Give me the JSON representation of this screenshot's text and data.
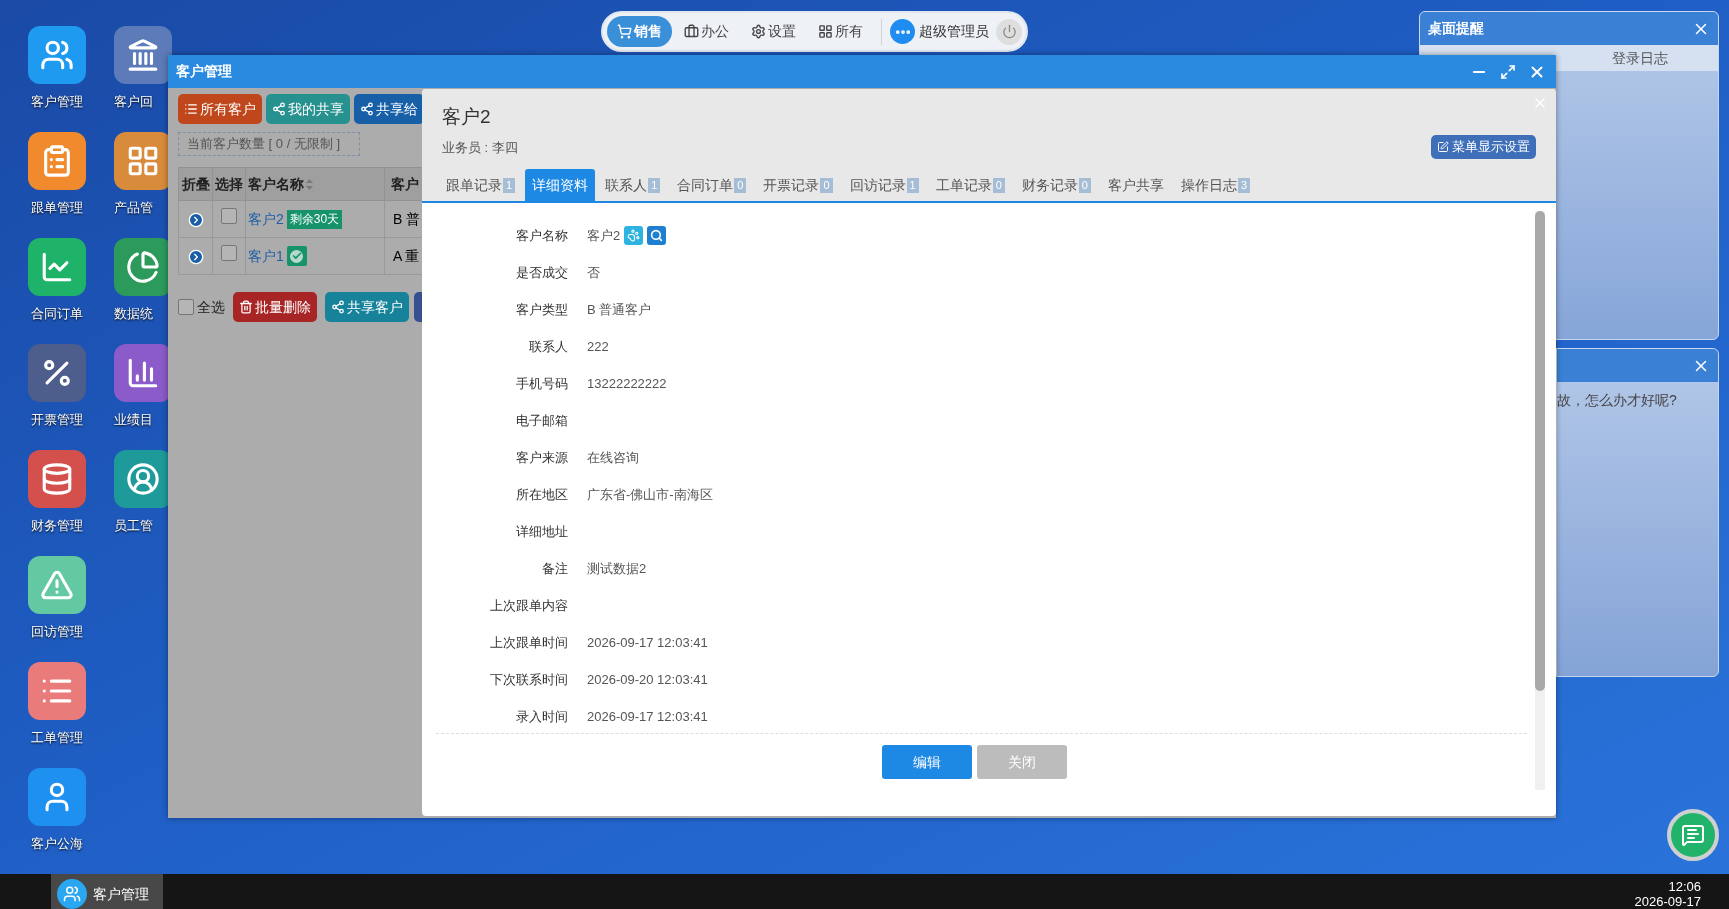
{
  "top_menu": {
    "items": [
      {
        "label": "销售",
        "selected": true
      },
      {
        "label": "办公",
        "selected": false
      },
      {
        "label": "设置",
        "selected": false
      },
      {
        "label": "所有",
        "selected": false
      }
    ],
    "user": {
      "name": "超级管理员"
    }
  },
  "desktop": {
    "columns": [
      [
        {
          "label": "客户管理",
          "color": "#1e9af0"
        },
        {
          "label": "跟单管理",
          "color": "#f08a2c"
        },
        {
          "label": "合同订单",
          "color": "#1fb36a"
        },
        {
          "label": "开票管理",
          "color": "#4d5d8c"
        },
        {
          "label": "财务管理",
          "color": "#d4504c"
        },
        {
          "label": "回访管理",
          "color": "#62c9a3"
        },
        {
          "label": "工单管理",
          "color": "#e97b7b"
        },
        {
          "label": "客户公海",
          "color": "#1e90f0"
        }
      ],
      [
        {
          "label": "客户回",
          "color": "#5c7bb8"
        },
        {
          "label": "产品管",
          "color": "#d88b3a"
        },
        {
          "label": "数据统",
          "color": "#2b9a5b"
        },
        {
          "label": "业绩目",
          "color": "#8b5bc9"
        },
        {
          "label": "员工管",
          "color": "#1f9a9a"
        }
      ]
    ]
  },
  "reminder_panel": {
    "title": "桌面提醒",
    "tabs": [
      {
        "label": "登录日志"
      }
    ]
  },
  "message_panel": {
    "message": "故，怎么办才好呢?"
  },
  "window": {
    "title": "客户管理",
    "toolbar": [
      {
        "label": "所有客户",
        "color": "#c0461b"
      },
      {
        "label": "我的共享",
        "color": "#27918f"
      },
      {
        "label": "共享给",
        "color": "#1760a8"
      }
    ],
    "count_label": "当前客户数量 [ 0 / 无限制 ]",
    "table": {
      "columns": [
        "折叠",
        "选择",
        "客户名称",
        "客户"
      ],
      "rows": [
        {
          "name": "客户2",
          "badge": "剩余30天",
          "verified": false,
          "checked": false,
          "type": "B 普"
        },
        {
          "name": "客户1",
          "verified": true,
          "checked": false,
          "type": "A 重"
        }
      ]
    },
    "select_all": {
      "label": "全选",
      "checked": false
    },
    "footer_buttons": [
      {
        "label": "批量删除",
        "color": "#a82525"
      },
      {
        "label": "共享客户",
        "color": "#16839a"
      },
      {
        "color": "#36508f"
      }
    ],
    "modal": {
      "title": "客户2",
      "subtitle": "业务员 : 李四",
      "settings_button": "菜单显示设置",
      "tabs": [
        {
          "label": "跟单记录",
          "count": "1",
          "selected": false
        },
        {
          "label": "详细资料",
          "selected": true
        },
        {
          "label": "联系人",
          "count": "1",
          "selected": false
        },
        {
          "label": "合同订单",
          "count": "0",
          "selected": false
        },
        {
          "label": "开票记录",
          "count": "0",
          "selected": false
        },
        {
          "label": "回访记录",
          "count": "1",
          "selected": false
        },
        {
          "label": "工单记录",
          "count": "0",
          "selected": false
        },
        {
          "label": "财务记录",
          "count": "0",
          "selected": false
        },
        {
          "label": "客户共享",
          "selected": false
        },
        {
          "label": "操作日志",
          "count": "3",
          "selected": false
        }
      ],
      "fields": [
        {
          "label": "客户名称",
          "value": "客户2",
          "kind": "name"
        },
        {
          "label": "是否成交",
          "value": "否",
          "kind": "text"
        },
        {
          "label": "客户类型",
          "value": "B 普通客户",
          "kind": "text"
        },
        {
          "label": "联系人",
          "value": "222",
          "kind": "text"
        },
        {
          "label": "手机号码",
          "value": "13222222222",
          "kind": "text"
        },
        {
          "label": "电子邮箱",
          "kind": "text"
        },
        {
          "label": "客户来源",
          "value": "在线咨询",
          "kind": "text"
        },
        {
          "label": "所在地区",
          "value": "广东省-佛山市-南海区",
          "kind": "text"
        },
        {
          "label": "详细地址",
          "kind": "text"
        },
        {
          "label": "备注",
          "value": "测试数据2",
          "kind": "text"
        },
        {
          "label": "上次跟单内容",
          "kind": "text"
        },
        {
          "label": "上次跟单时间",
          "value": "2026-09-17 12:03:41",
          "kind": "text"
        },
        {
          "label": "下次联系时间",
          "value": "2026-09-20 12:03:41",
          "kind": "text"
        },
        {
          "label": "录入时间",
          "value": "2026-09-17 12:03:41",
          "kind": "text"
        }
      ],
      "buttons": [
        {
          "label": "编辑",
          "kind": "primary"
        },
        {
          "label": "关闭",
          "kind": "secondary"
        }
      ]
    }
  },
  "taskbar": {
    "items": [
      {
        "label": "客户管理",
        "selected": true
      }
    ],
    "time": "12:06",
    "date": "2026-09-17"
  }
}
